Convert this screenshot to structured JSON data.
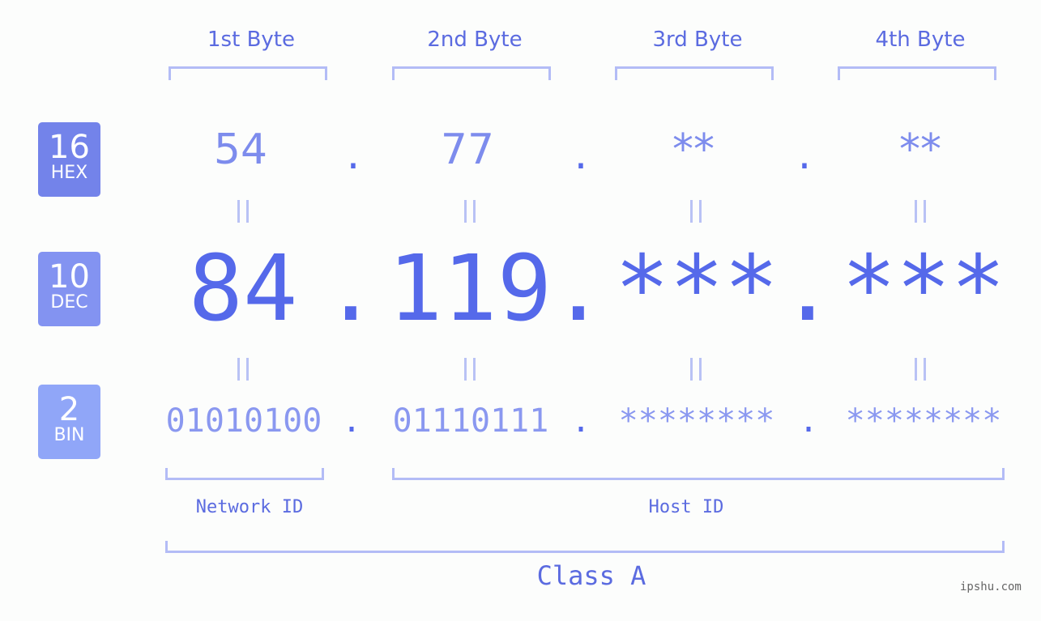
{
  "bytes": {
    "labels": [
      "1st Byte",
      "2nd Byte",
      "3rd Byte",
      "4th Byte"
    ]
  },
  "badges": {
    "hex": {
      "num": "16",
      "base": "HEX",
      "color": "#7383ea"
    },
    "dec": {
      "num": "10",
      "base": "DEC",
      "color": "#8393f1"
    },
    "bin": {
      "num": "2",
      "base": "BIN",
      "color": "#90a6f8"
    }
  },
  "hex_values": [
    "54",
    "77",
    "**",
    "**"
  ],
  "dec_values": [
    "84",
    "119",
    "***",
    "***"
  ],
  "bin_values": [
    "01010100",
    "01110111",
    "********",
    "********"
  ],
  "separator": ".",
  "network_id_label": "Network ID",
  "host_id_label": "Host ID",
  "class_label": "Class A",
  "watermark": "ipshu.com"
}
